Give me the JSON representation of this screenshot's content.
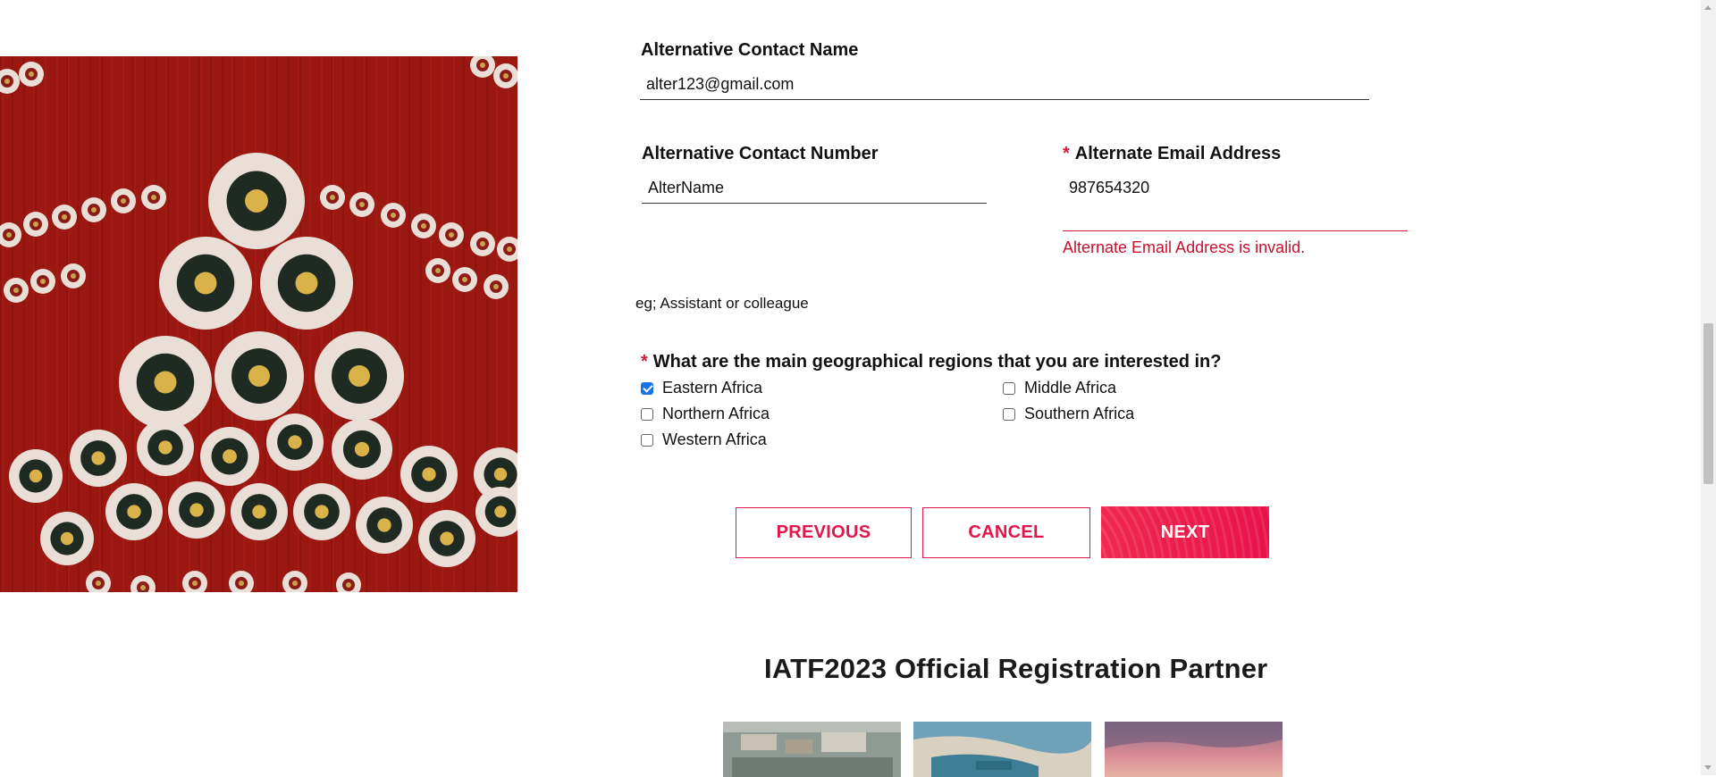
{
  "form": {
    "alt_contact_name": {
      "label": "Alternative Contact Name",
      "value": "alter123@gmail.com"
    },
    "alt_contact_number": {
      "label": "Alternative Contact Number",
      "value": "AlterName"
    },
    "alt_email": {
      "required_marker": "*",
      "label": "Alternate Email Address",
      "value": "987654320",
      "error": "Alternate Email Address is invalid."
    },
    "hint": "eg; Assistant or colleague",
    "regions": {
      "required_marker": "*",
      "question": "What are the main geographical regions that you are interested in?",
      "options": [
        {
          "label": "Eastern Africa",
          "checked": true
        },
        {
          "label": "Middle Africa",
          "checked": false
        },
        {
          "label": "Northern Africa",
          "checked": false
        },
        {
          "label": "Southern Africa",
          "checked": false
        },
        {
          "label": "Western Africa",
          "checked": false
        }
      ]
    },
    "buttons": {
      "previous": "PREVIOUS",
      "cancel": "CANCEL",
      "next": "NEXT"
    }
  },
  "partner_section": {
    "title": "IATF2023 Official Registration Partner"
  },
  "colors": {
    "accent": "#e0174a",
    "error": "#c8102e",
    "checkbox_checked": "#1a73e8"
  }
}
